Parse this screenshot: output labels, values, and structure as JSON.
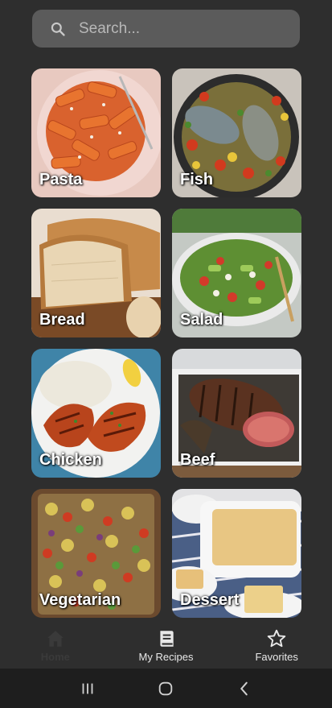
{
  "search": {
    "placeholder": "Search..."
  },
  "categories": [
    {
      "label": "Pasta"
    },
    {
      "label": "Fish"
    },
    {
      "label": "Bread"
    },
    {
      "label": "Salad"
    },
    {
      "label": "Chicken"
    },
    {
      "label": "Beef"
    },
    {
      "label": "Vegetarian"
    },
    {
      "label": "Dessert"
    }
  ],
  "bottom_nav": {
    "items": [
      {
        "label": "Home",
        "icon": "home-icon",
        "active": true
      },
      {
        "label": "My Recipes",
        "icon": "book-icon",
        "active": false
      },
      {
        "label": "Favorites",
        "icon": "star-icon",
        "active": false
      }
    ]
  },
  "system_nav": {
    "icons": [
      "recent-apps-icon",
      "home-circle-icon",
      "back-icon"
    ]
  },
  "colors": {
    "background": "#2e2e2e",
    "search_bg": "#5b5b5b",
    "active_nav": "#3a3a3a"
  }
}
